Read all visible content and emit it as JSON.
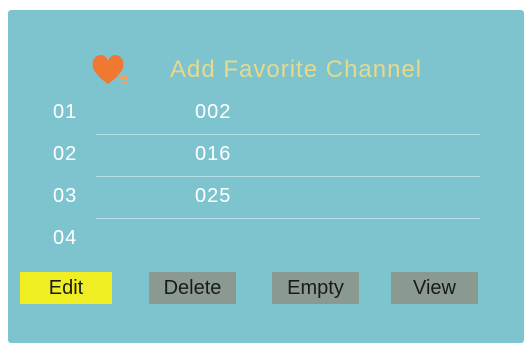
{
  "header": {
    "title": "Add Favorite Channel",
    "icon": "heart-icon"
  },
  "favorites": [
    {
      "slot": "01",
      "channel": "002"
    },
    {
      "slot": "02",
      "channel": "016"
    },
    {
      "slot": "03",
      "channel": "025"
    },
    {
      "slot": "04",
      "channel": ""
    }
  ],
  "buttons": {
    "edit": "Edit",
    "delete": "Delete",
    "empty": "Empty",
    "view": "View"
  },
  "colors": {
    "background": "#7ec4cf",
    "title": "#e8d88a",
    "heart": "#f07830",
    "selected_button": "#eeee22",
    "button": "#8a9a90"
  }
}
